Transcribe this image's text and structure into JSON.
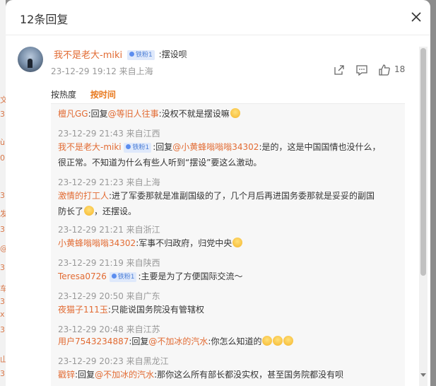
{
  "dialog": {
    "title": "12条回复"
  },
  "background_edge_glyphs": [
    "文",
    "3",
    "ù",
    "0",
    "3",
    "发",
    "3",
    "@",
    "3",
    "车",
    "3",
    "x",
    "3",
    "山",
    "3"
  ],
  "comment": {
    "author": "我不是老大-miki",
    "badge": "铁粉1",
    "text": ":摆设呗",
    "meta": "23-12-29 19:12 来自上海",
    "likes": "18"
  },
  "sort": {
    "hot": "按热度",
    "time": "按时间"
  },
  "replies": [
    {
      "name": "檀凡GG",
      "badge": "",
      "pre": ":回复",
      "at": "@等旧人往事",
      "text": ":没权不就是摆设嘛",
      "emojis": 1,
      "meta": "23-12-29 21:43 来自江西"
    },
    {
      "name": "我不是老大-miki",
      "badge": "铁粉1",
      "pre": ":回复",
      "at": "@小黄蜂嗡嗡嗡34302",
      "text": ":是的，这是中国国情也没什么，",
      "text2": "很正常。不知道为什么有些人听到“摆设”要这么激动。",
      "emojis": 0,
      "meta": "23-12-29 21:23 来自上海"
    },
    {
      "name": "激情的打工人",
      "badge": "",
      "pre": "",
      "at": "",
      "text": ":进了军委那就是准副国级的了，几个月后再进国务委那就是妥妥的副国",
      "text2": "防长了",
      "text2b": "，还摆设。",
      "emojis": 1,
      "meta": "23-12-29 21:21 来自浙江"
    },
    {
      "name": "小黄蜂嗡嗡嗡34302",
      "badge": "",
      "pre": "",
      "at": "",
      "text": ":军事不归政府，归党中央",
      "emojis": 1,
      "meta": "23-12-29 21:19 来自陕西"
    },
    {
      "name": "Teresa0726",
      "badge": "铁粉1",
      "pre": "",
      "at": "",
      "text": ":主要是为了方便国际交流～",
      "emojis": 0,
      "meta": "23-12-29 20:50 来自广东"
    },
    {
      "name": "夜猫子111玉",
      "badge": "",
      "pre": "",
      "at": "",
      "text": ":只能说国务院没有管辖权",
      "emojis": 0,
      "meta": "23-12-29 20:48 来自江苏"
    },
    {
      "name": "用户7543234887",
      "badge": "",
      "pre": ":回复",
      "at": "@不加冰的汽水",
      "text": ":你怎么知道的",
      "emojis": 3,
      "meta": "23-12-29 20:23 来自黑龙江"
    },
    {
      "name": "戳锌",
      "badge": "",
      "pre": ":回复",
      "at": "@不加冰的汽水",
      "text": ":那你这么所有部长都没实权，甚至国务院都没有呗",
      "emojis": 0,
      "meta": ""
    }
  ]
}
